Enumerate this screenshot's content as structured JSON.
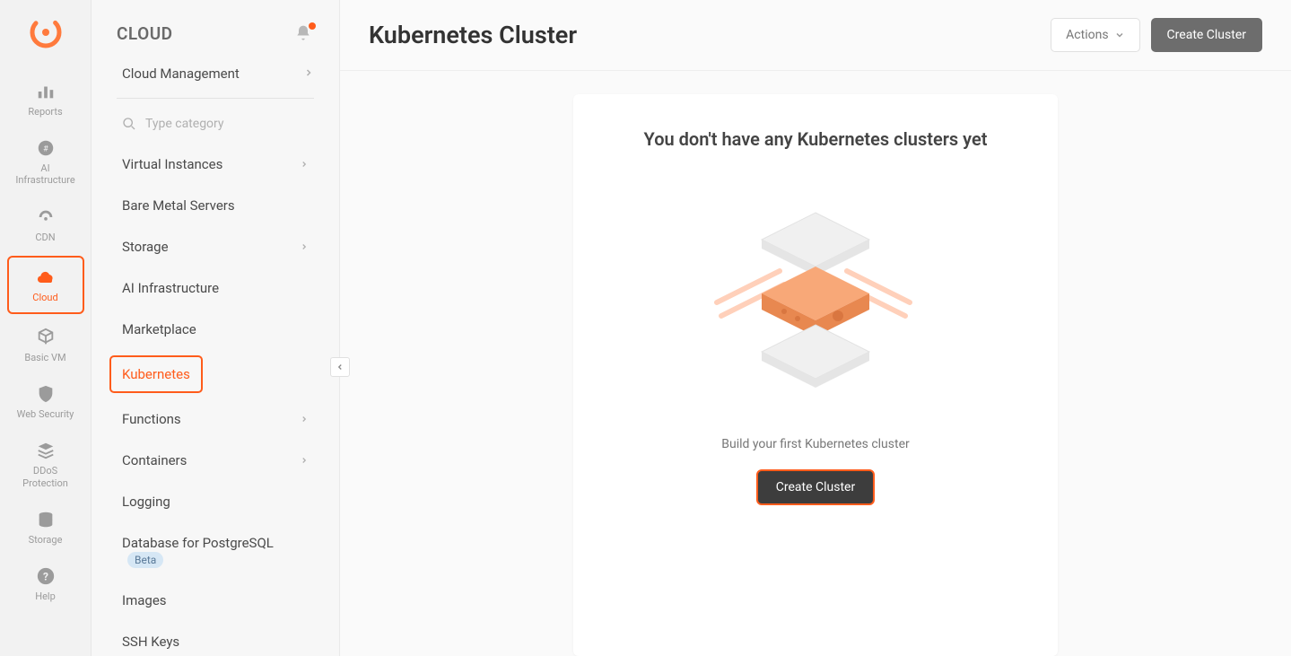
{
  "rail": {
    "items": [
      {
        "label": "Reports"
      },
      {
        "label": "AI Infrastructure"
      },
      {
        "label": "CDN"
      },
      {
        "label": "Cloud"
      },
      {
        "label": "Basic VM"
      },
      {
        "label": "Web Security"
      },
      {
        "label": "DDoS Protection"
      },
      {
        "label": "Storage"
      },
      {
        "label": "Help"
      }
    ]
  },
  "sidebar": {
    "title": "CLOUD",
    "top_link": "Cloud Management",
    "search_placeholder": "Type category",
    "items": [
      {
        "label": "Virtual Instances",
        "expandable": true
      },
      {
        "label": "Bare Metal Servers"
      },
      {
        "label": "Storage",
        "expandable": true
      },
      {
        "label": "AI Infrastructure"
      },
      {
        "label": "Marketplace"
      },
      {
        "label": "Kubernetes",
        "active": true
      },
      {
        "label": "Functions",
        "expandable": true
      },
      {
        "label": "Containers",
        "expandable": true
      },
      {
        "label": "Logging"
      },
      {
        "label": "Database for PostgreSQL",
        "badge": "Beta"
      },
      {
        "label": "Images"
      },
      {
        "label": "SSH Keys"
      }
    ]
  },
  "main": {
    "title": "Kubernetes Cluster",
    "actions_label": "Actions",
    "create_label": "Create Cluster",
    "empty": {
      "title": "You don't have any Kubernetes clusters yet",
      "subtitle": "Build your first Kubernetes cluster",
      "button": "Create Cluster"
    }
  }
}
